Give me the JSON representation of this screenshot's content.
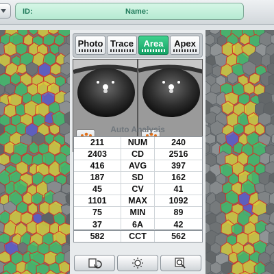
{
  "header": {
    "id_label": "ID:",
    "name_label": "Name:"
  },
  "tabs": [
    {
      "label": "Photo",
      "active": false
    },
    {
      "label": "Trace",
      "active": false
    },
    {
      "label": "Area",
      "active": true
    },
    {
      "label": "Apex",
      "active": false
    }
  ],
  "analysis": {
    "title": "Auto Analysis",
    "rows": [
      {
        "left": "211",
        "metric": "NUM",
        "right": "240"
      },
      {
        "left": "2403",
        "metric": "CD",
        "right": "2516"
      },
      {
        "left": "416",
        "metric": "AVG",
        "right": "397"
      },
      {
        "left": "187",
        "metric": "SD",
        "right": "162"
      },
      {
        "left": "45",
        "metric": "CV",
        "right": "41"
      },
      {
        "left": "1101",
        "metric": "MAX",
        "right": "1092"
      },
      {
        "left": "75",
        "metric": "MIN",
        "right": "89"
      },
      {
        "left": "37",
        "metric": "6A",
        "right": "42"
      }
    ],
    "cct": {
      "left": "582",
      "metric": "CCT",
      "right": "562"
    }
  },
  "toolbar": {
    "icons": [
      "rotate-icon",
      "brightness-icon",
      "zoom-icon"
    ]
  },
  "colors": {
    "accent_green": "#14a265",
    "header_green": "#1f7a5a",
    "cell_green": "#3fbf6a",
    "cell_yellow": "#d7cf3c",
    "cell_blue": "#5a5ad0",
    "cell_border": "#d0342c"
  }
}
